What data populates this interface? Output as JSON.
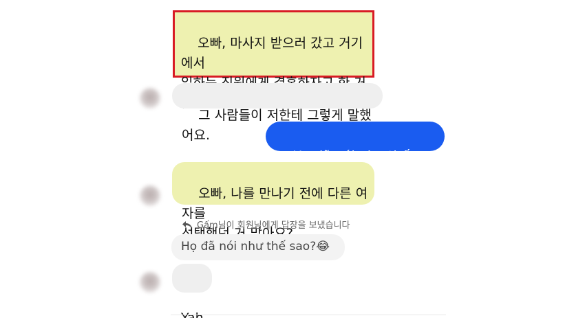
{
  "messages": {
    "m1": "오빠, 마사지 받으러 갔고 거기에서\n일하는 직원에게 결혼하자고 한 거\n맞아요?",
    "m2": "그 사람들이 저한테 그렇게 말했어요.",
    "m3_text": "Họ đã nói như thế sao?",
    "m3_emoji": "😂",
    "m4": "오빠, 나를 만나기 전에 다른 여자를\n선택했던 거 맞아요?",
    "reply_note": "Gấm님이 회원님에게 답장을 보냈습니다",
    "quoted_text": "Họ đã nói như thế sao?",
    "quoted_emoji": "😂",
    "m5": "Yah"
  },
  "icons": {
    "reply": "reply-arrow-icon",
    "avatar": "blurred-avatar"
  },
  "colors": {
    "highlight_border": "#d81b24",
    "yellow_bubble": "#eef1b0",
    "gray_bubble": "#efefef",
    "blue_bubble": "#1a5cf0"
  }
}
